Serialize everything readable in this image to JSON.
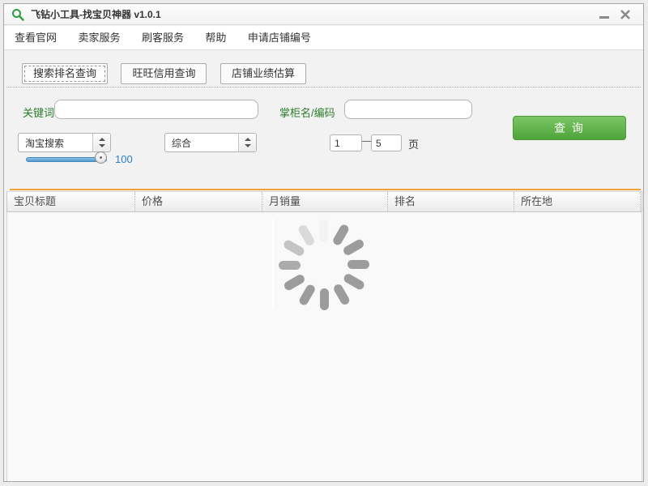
{
  "window": {
    "title": "飞钻小工具-找宝贝神器 v1.0.1"
  },
  "icons": {
    "app": "search-icon",
    "minimize": "minimize-icon",
    "close": "close-icon",
    "combo": "updown-arrows-icon",
    "loading": "spinner-icon"
  },
  "menu": {
    "items": [
      {
        "label": "查看官网"
      },
      {
        "label": "卖家服务"
      },
      {
        "label": "刷客服务"
      },
      {
        "label": "帮助"
      },
      {
        "label": "申请店铺编号"
      }
    ]
  },
  "tabs": {
    "items": [
      {
        "label": "搜索排名查询",
        "active": true
      },
      {
        "label": "旺旺信用查询",
        "active": false
      },
      {
        "label": "店铺业绩估算",
        "active": false
      }
    ]
  },
  "form": {
    "keyword_label": "关键词",
    "keyword_value": "",
    "shop_label": "掌柜名/编码",
    "shop_value": "",
    "search_source_value": "淘宝搜索",
    "sort_value": "综合",
    "page_from": "1",
    "page_dash": "—",
    "page_to": "5",
    "page_unit": "页",
    "slider_value": "100",
    "query_button": "查 询"
  },
  "table": {
    "columns": [
      {
        "label": "宝贝标题"
      },
      {
        "label": "价格"
      },
      {
        "label": "月销量"
      },
      {
        "label": "排名"
      },
      {
        "label": "所在地"
      }
    ]
  },
  "colors": {
    "accent_green": "#4fa43a",
    "label_green": "#2a7e2a",
    "header_accent_orange": "#f0a232",
    "slider_blue": "#4e9bd4",
    "slider_value_blue": "#2a7fc9"
  }
}
